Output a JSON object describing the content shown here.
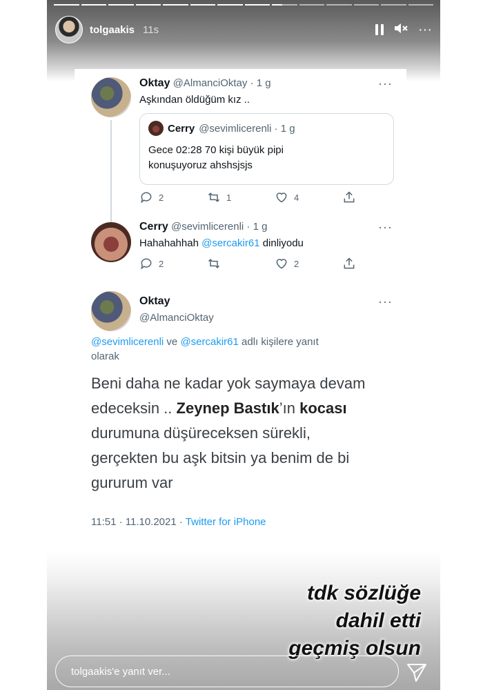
{
  "story": {
    "username": "tolgaakis",
    "age": "11s",
    "overlay_lines": [
      "tdk sözlüğe",
      "dahil etti",
      "geçmiş olsun"
    ],
    "reply_placeholder": "tolgaakis'e yanıt ver...",
    "progress": {
      "segments": 14,
      "completed": 8
    }
  },
  "tweets": {
    "t1": {
      "name": "Oktay",
      "handle_time": "@AlmanciOktay · 1 g",
      "text": "Aşkından öldüğüm kız ..",
      "quote": {
        "name": "Cerry",
        "handle_time": "@sevimlicerenli · 1 g",
        "text_line1": "Gece 02:28 70 kişi büyük pipi",
        "text_line2": "konuşuyoruz ahshsjsjs"
      },
      "replies": "2",
      "retweets": "1",
      "likes": "4"
    },
    "t2": {
      "name": "Cerry",
      "handle_time": "@sevimlicerenli · 1 g",
      "text_prefix": "Hahahahhah",
      "mention": "@sercakir61",
      "text_suffix": "dinliyodu",
      "replies": "2",
      "retweets": "",
      "likes": "2"
    },
    "t3": {
      "name": "Oktay",
      "handle": "@AlmanciOktay",
      "reply_mention1": "@sevimlicerenli",
      "reply_connector": "ve",
      "reply_mention2": "@sercakir61",
      "reply_suffix": "adlı kişilere yanıt",
      "reply_suffix2": "olarak",
      "line1": "Beni daha ne kadar yok saymaya devam",
      "line2a": "edeceksin ..",
      "line2b": "Zeynep Bastık",
      "line2c": "’ın",
      "line2d": "kocası",
      "line3": "durumuna düşüreceksen sürekli,",
      "line4": "gerçekten bu aşk bitsin ya benim de bi",
      "line5": "gururum var",
      "time": "11:51 · 11.10.2021 ·",
      "source": "Twitter for iPhone"
    }
  },
  "icons": {
    "more": "···",
    "mute": "speaker-muted-icon",
    "pause": "pause-icon",
    "send": "paper-plane-icon"
  }
}
